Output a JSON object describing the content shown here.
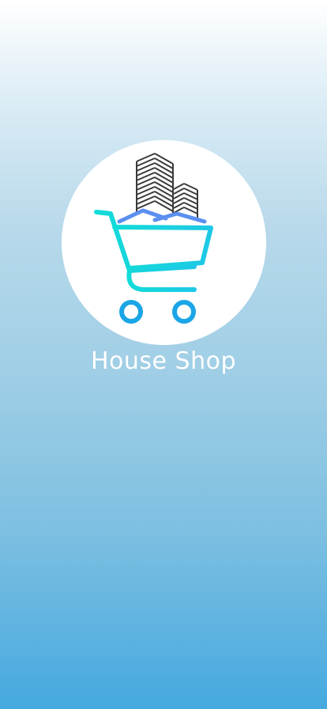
{
  "app": {
    "name": "House Shop"
  },
  "logo": {
    "icon": "shopping-cart-with-buildings-icon",
    "colors": {
      "cart": "#12dcd8",
      "wheels": "#1aa6e6",
      "roof": "#5b8ff0",
      "buildings": "#3a3a3a",
      "circle": "#ffffff"
    }
  },
  "theme": {
    "background_top": "#ffffff",
    "background_bottom": "#45a9df"
  }
}
